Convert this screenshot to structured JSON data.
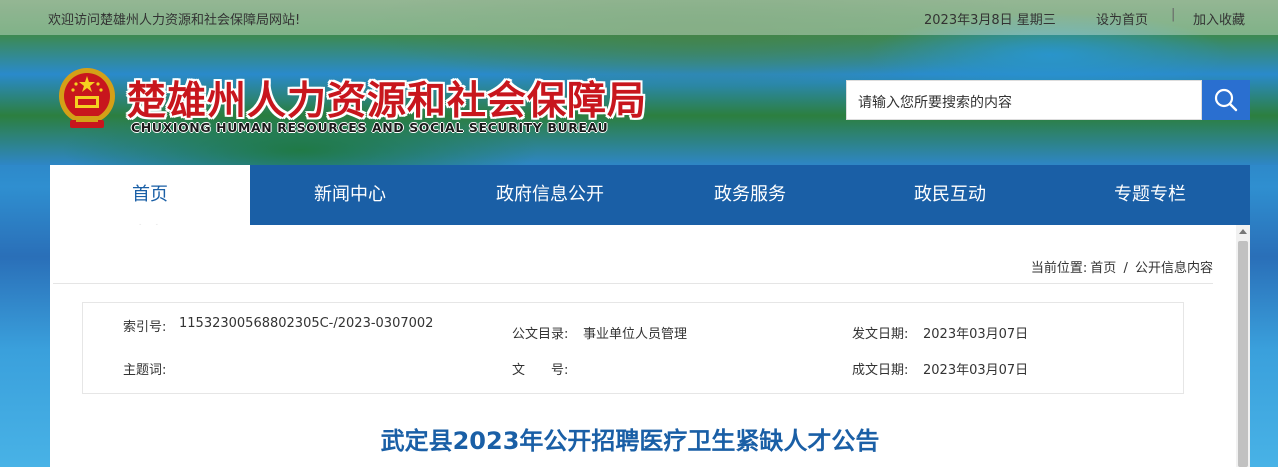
{
  "topbar": {
    "welcome": "欢迎访问楚雄州人力资源和社会保障局网站!",
    "date": "2023年3月8日  星期三",
    "set_homepage": "设为首页",
    "add_favorite": "加入收藏"
  },
  "header": {
    "title": "楚雄州人力资源和社会保障局",
    "subtitle": "CHUXIONG HUMAN RESOURCES AND SOCIAL SECURITY BUREAU",
    "search_placeholder": "请输入您所要搜索的内容"
  },
  "nav": {
    "items": [
      {
        "label": "首页"
      },
      {
        "label": "新闻中心"
      },
      {
        "label": "政府信息公开"
      },
      {
        "label": "政务服务"
      },
      {
        "label": "政民互动"
      },
      {
        "label": "专题专栏"
      }
    ]
  },
  "breadcrumb": {
    "prefix": "当前位置:",
    "home": "首页",
    "separator": "/",
    "current": "公开信息内容"
  },
  "meta": {
    "index_label": "索引号:",
    "index_value": "11532300568802305C-/2023-0307002",
    "catalog_label": "公文目录:",
    "catalog_value": "事业单位人员管理",
    "issue_date_label": "发文日期:",
    "issue_date_value": "2023年03月07日",
    "subject_label": "主题词:",
    "subject_value": "",
    "doc_no_label": "文　　号:",
    "doc_no_value": "",
    "created_date_label": "成文日期:",
    "created_date_value": "2023年03月07日"
  },
  "article": {
    "title": "武定县2023年公开招聘医疗卫生紧缺人才公告"
  },
  "colors": {
    "nav_bg": "#1a5fa6",
    "title_red": "#c8161d",
    "search_btn": "#2a6fd0"
  }
}
